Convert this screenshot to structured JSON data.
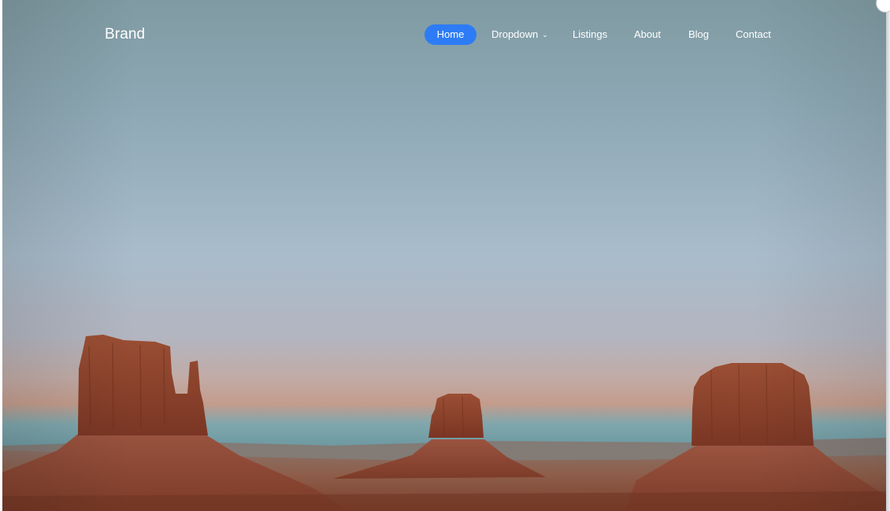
{
  "navbar": {
    "brand": "Brand",
    "items": [
      {
        "label": "Home",
        "active": true
      },
      {
        "label": "Dropdown",
        "has_dropdown": true
      },
      {
        "label": "Listings"
      },
      {
        "label": "About"
      },
      {
        "label": "Blog"
      },
      {
        "label": "Contact"
      }
    ],
    "chevron_icon": "chevron-down-icon",
    "active_color": "#2d7cf6"
  },
  "hero": {
    "scene": "desert mesas and buttes at dusk under a blue-grey sky"
  }
}
